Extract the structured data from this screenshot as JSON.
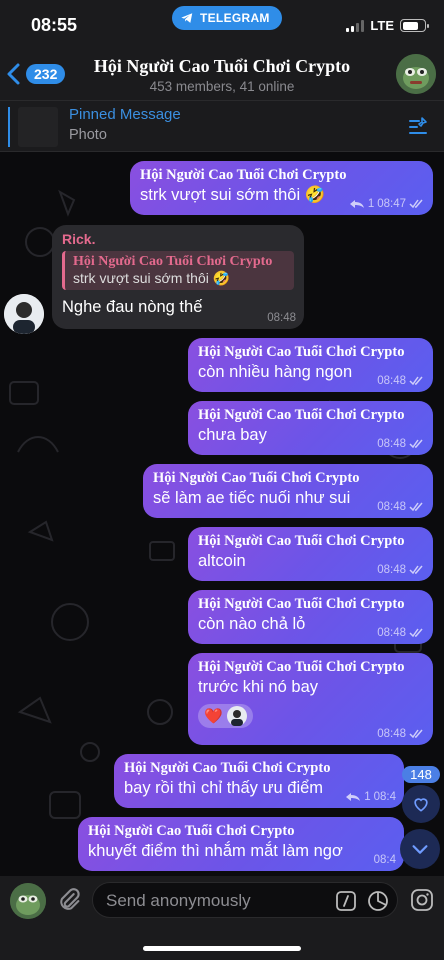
{
  "status": {
    "time": "08:55",
    "app_pill": "TELEGRAM",
    "network": "LTE"
  },
  "header": {
    "back_count": "232",
    "title": "Hội Người Cao Tuổi Chơi Crypto",
    "subtitle": "453 members, 41 online"
  },
  "pinned": {
    "title": "Pinned Message",
    "subtitle": "Photo"
  },
  "messages": [
    {
      "sender": "Hội Người Cao Tuổi Chơi Crypto",
      "text": "strk vượt sui sớm thôi 🤣",
      "reply_count": "1",
      "time": "08:47"
    },
    {
      "sender": "Rick.",
      "reply_sender": "Hội Người Cao Tuổi Chơi Crypto",
      "reply_text": "strk vượt sui sớm thôi 🤣",
      "text": "Nghe đau nòng thế",
      "time": "08:48"
    },
    {
      "sender": "Hội Người Cao Tuổi Chơi Crypto",
      "text": "còn nhiều hàng ngon",
      "time": "08:48"
    },
    {
      "sender": "Hội Người Cao Tuổi Chơi Crypto",
      "text": "chưa bay",
      "time": "08:48"
    },
    {
      "sender": "Hội Người Cao Tuổi Chơi Crypto",
      "text": "sẽ làm ae tiếc nuối như sui",
      "time": "08:48"
    },
    {
      "sender": "Hội Người Cao Tuổi Chơi Crypto",
      "text": "altcoin",
      "time": "08:48"
    },
    {
      "sender": "Hội Người Cao Tuổi Chơi Crypto",
      "text": "còn nào chả lỏ",
      "time": "08:48"
    },
    {
      "sender": "Hội Người Cao Tuổi Chơi Crypto",
      "text": "trước khi nó bay",
      "time": "08:48",
      "reaction": "❤️"
    },
    {
      "sender": "Hội Người Cao Tuổi Chơi Crypto",
      "text": "bay rồi thì chỉ thấy ưu điểm",
      "reply_count": "1",
      "time": "08:4"
    },
    {
      "sender": "Hội Người Cao Tuổi Chơi Crypto",
      "text": "khuyết điểm thì nhắm mắt làm ngơ",
      "time": "08:4"
    }
  ],
  "likes_count": "148",
  "input": {
    "placeholder": "Send anonymously"
  },
  "colors": {
    "accent": "#2f8de8",
    "bubble_out": "#7a52e6",
    "bubble_in": "#2a2a2e",
    "reply_name": "#e46a8e"
  }
}
